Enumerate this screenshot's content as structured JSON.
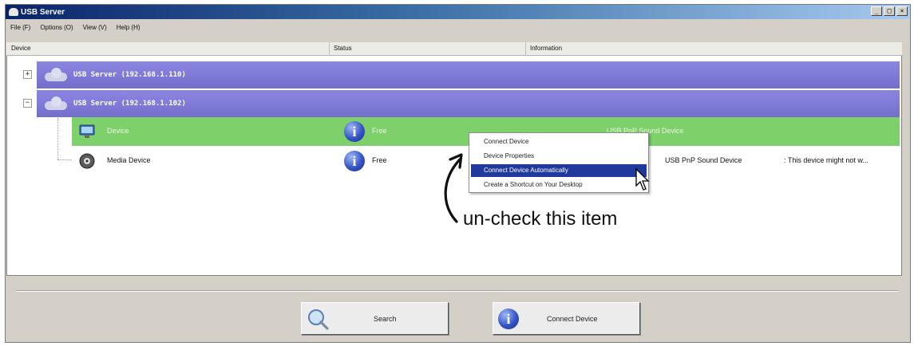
{
  "window": {
    "title": "USB Server",
    "controls": [
      "_",
      "□",
      "×"
    ]
  },
  "menu": [
    "File (F)",
    "Options (O)",
    "View (V)",
    "Help (H)"
  ],
  "columns": [
    "Device",
    "Status",
    "Information"
  ],
  "servers": [
    {
      "label": "USB Server (192.168.1.110)",
      "expander": "+"
    },
    {
      "label": "USB Server (192.168.1.102)",
      "expander": "−"
    }
  ],
  "devices": [
    {
      "name": "Device",
      "status": "Free",
      "information": "USB PnP Sound Device"
    },
    {
      "name": "Media Device",
      "status": "Free",
      "information": "USB PnP Sound Device",
      "note": ": This device might not w..."
    }
  ],
  "context_menu": {
    "items": [
      "Connect Device",
      "Device Properties",
      "Connect Device Automatically",
      "Create a Shortcut on Your Desktop"
    ],
    "highlighted_index": 2
  },
  "annotation": "un-check this item",
  "buttons": {
    "search": "Search",
    "connect": "Connect Device"
  },
  "colors": {
    "server_row": "#7f7bd8",
    "selected_row": "#7ed06b",
    "menu_highlight": "#1f3a9c"
  }
}
